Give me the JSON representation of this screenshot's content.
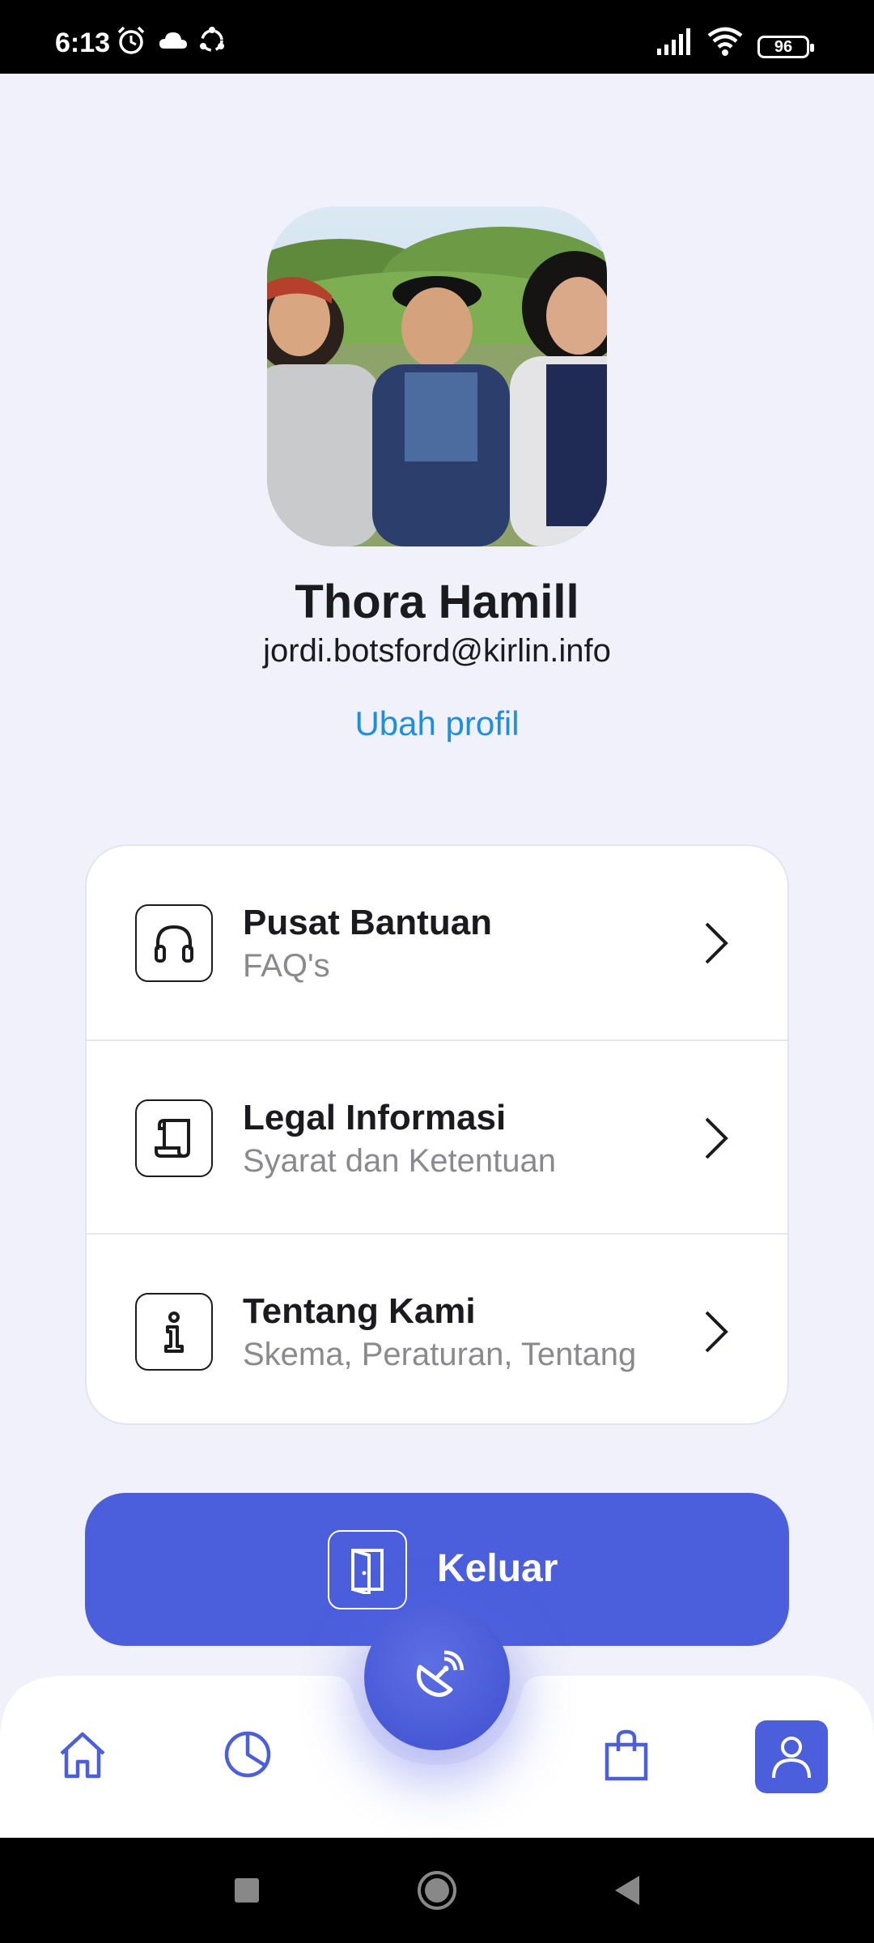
{
  "status_bar": {
    "time": "6:13",
    "battery": "96",
    "icons": [
      "alarm-icon",
      "cloud-icon",
      "sync-icon",
      "signal-icon",
      "wifi-icon",
      "battery-icon"
    ]
  },
  "profile": {
    "avatar_alt": "avatar",
    "name": "Thora Hamill",
    "email": "jordi.botsford@kirlin.info",
    "edit_label": "Ubah profil"
  },
  "menu": {
    "items": [
      {
        "title": "Pusat Bantuan",
        "subtitle": "FAQ's",
        "icon": "headphones-icon"
      },
      {
        "title": "Legal Informasi",
        "subtitle": "Syarat dan Ketentuan",
        "icon": "scroll-icon"
      },
      {
        "title": "Tentang Kami",
        "subtitle": "Skema, Peraturan, Tentang",
        "icon": "info-icon"
      }
    ]
  },
  "logout": {
    "label": "Keluar",
    "icon": "door-exit-icon"
  },
  "bottom_nav": {
    "items": [
      "home-icon",
      "pie-chart-icon",
      "satellite-dish-icon",
      "shopping-bag-icon",
      "user-icon"
    ],
    "active": "user-icon"
  },
  "colors": {
    "accent": "#4b5fdc",
    "link": "#1e8fe0",
    "background": "#f1f1fb",
    "muted_text": "#8a8a8e"
  }
}
